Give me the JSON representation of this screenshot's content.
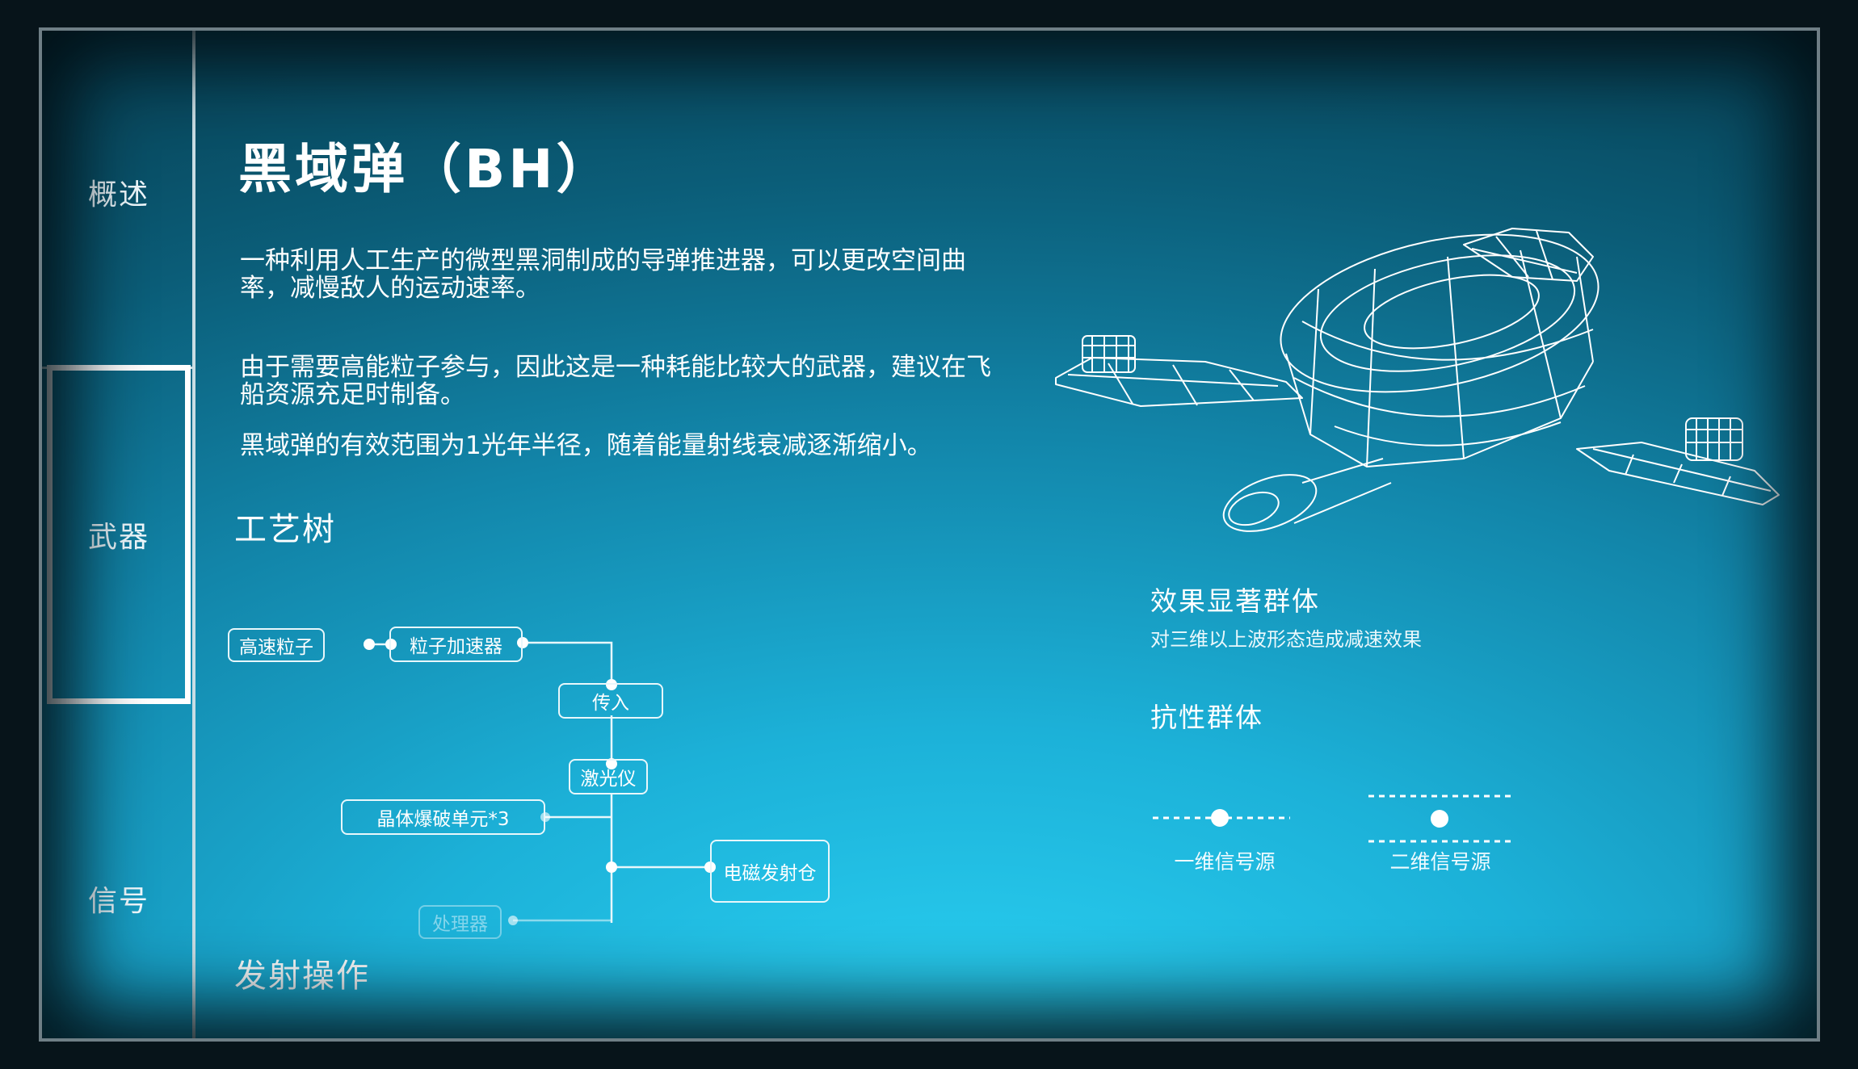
{
  "sidebar": {
    "items": [
      {
        "label": "概述",
        "active": false
      },
      {
        "label": "武器",
        "active": true
      },
      {
        "label": "信号",
        "active": false
      }
    ]
  },
  "weapon": {
    "title": "黑域弹（BH）",
    "description": [
      "一种利用人工生产的微型黑洞制成的导弹推进器，可以更改空间曲率，减慢敌人的运动速率。",
      "由于需要高能粒子参与，因此这是一种耗能比较大的武器，建议在飞船资源充足时制备。",
      "黑域弹的有效范围为1光年半径，随着能量射线衰减逐渐缩小。"
    ]
  },
  "craft_tree": {
    "heading": "工艺树",
    "nodes": [
      {
        "id": "hs",
        "label": "高速粒子"
      },
      {
        "id": "acc",
        "label": "粒子加速器"
      },
      {
        "id": "in",
        "label": "传入"
      },
      {
        "id": "laser",
        "label": "激光仪"
      },
      {
        "id": "crys",
        "label": "晶体爆破单元*3"
      },
      {
        "id": "em",
        "label": "电磁发射仓"
      },
      {
        "id": "proc",
        "label": "处理器",
        "dimmed": true
      }
    ]
  },
  "launch": {
    "heading": "发射操作"
  },
  "effects": {
    "effective_title": "效果显著群体",
    "effective_desc": "对三维以上波形态造成减速效果",
    "resistant_title": "抗性群体",
    "signals": [
      {
        "label": "一维信号源",
        "icon": "one-dimension-signal-icon"
      },
      {
        "label": "二维信号源",
        "icon": "two-dimension-signal-icon"
      }
    ]
  },
  "colors": {
    "line": "#e8f7fb",
    "panel_top": "#073f52",
    "panel_bottom": "#2ad0f2"
  }
}
